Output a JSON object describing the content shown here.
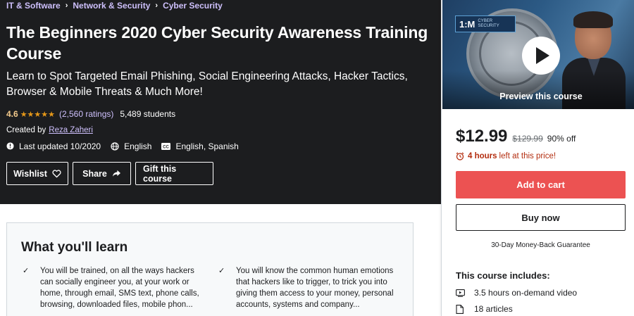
{
  "breadcrumb": {
    "items": [
      "IT & Software",
      "Network & Security",
      "Cyber Security"
    ]
  },
  "course": {
    "title": "The Beginners 2020 Cyber Security Awareness Training Course",
    "subtitle": "Learn to Spot Targeted Email Phishing, Social Engineering Attacks, Hacker Tactics, Browser & Mobile Threats & Much More!",
    "rating": "4.6",
    "stars": 4.5,
    "ratings_count": "(2,560 ratings)",
    "students": "5,489 students",
    "created_by_label": "Created by",
    "author": "Reza Zaheri",
    "last_updated": "Last updated 10/2020",
    "language": "English",
    "captions": "English, Spanish"
  },
  "actions": {
    "wishlist": "Wishlist",
    "share": "Share",
    "gift": "Gift this course"
  },
  "sidebar": {
    "preview_label": "Preview this course",
    "logo_text": "1:M",
    "logo_subtext": "CYBER SECURITY",
    "price": "$12.99",
    "original_price": "$129.99",
    "discount": "90% off",
    "timer_bold": "4 hours",
    "timer_rest": "left at this price!",
    "add_to_cart": "Add to cart",
    "buy_now": "Buy now",
    "guarantee": "30-Day Money-Back Guarantee",
    "includes_title": "This course includes:",
    "includes": [
      {
        "icon": "video-icon",
        "label": "3.5 hours on-demand video"
      },
      {
        "icon": "file-icon",
        "label": "18 articles"
      }
    ]
  },
  "learn": {
    "title": "What you'll learn",
    "items": [
      "You will be trained, on all the ways hackers can socially engineer you, at your work or home, through email, SMS text, phone calls, browsing, downloaded files, mobile phon...",
      "You will know the common human emotions that hackers like to trigger, to trick you into giving them access to your money, personal accounts, systems and company..."
    ]
  },
  "colors": {
    "hero_bg": "#1c1d1f",
    "link_purple": "#cec0fc",
    "rating_gold": "#f3ca8c",
    "star": "#e59819",
    "cart_red": "#ec5252",
    "timer_red": "#b32d0f"
  }
}
